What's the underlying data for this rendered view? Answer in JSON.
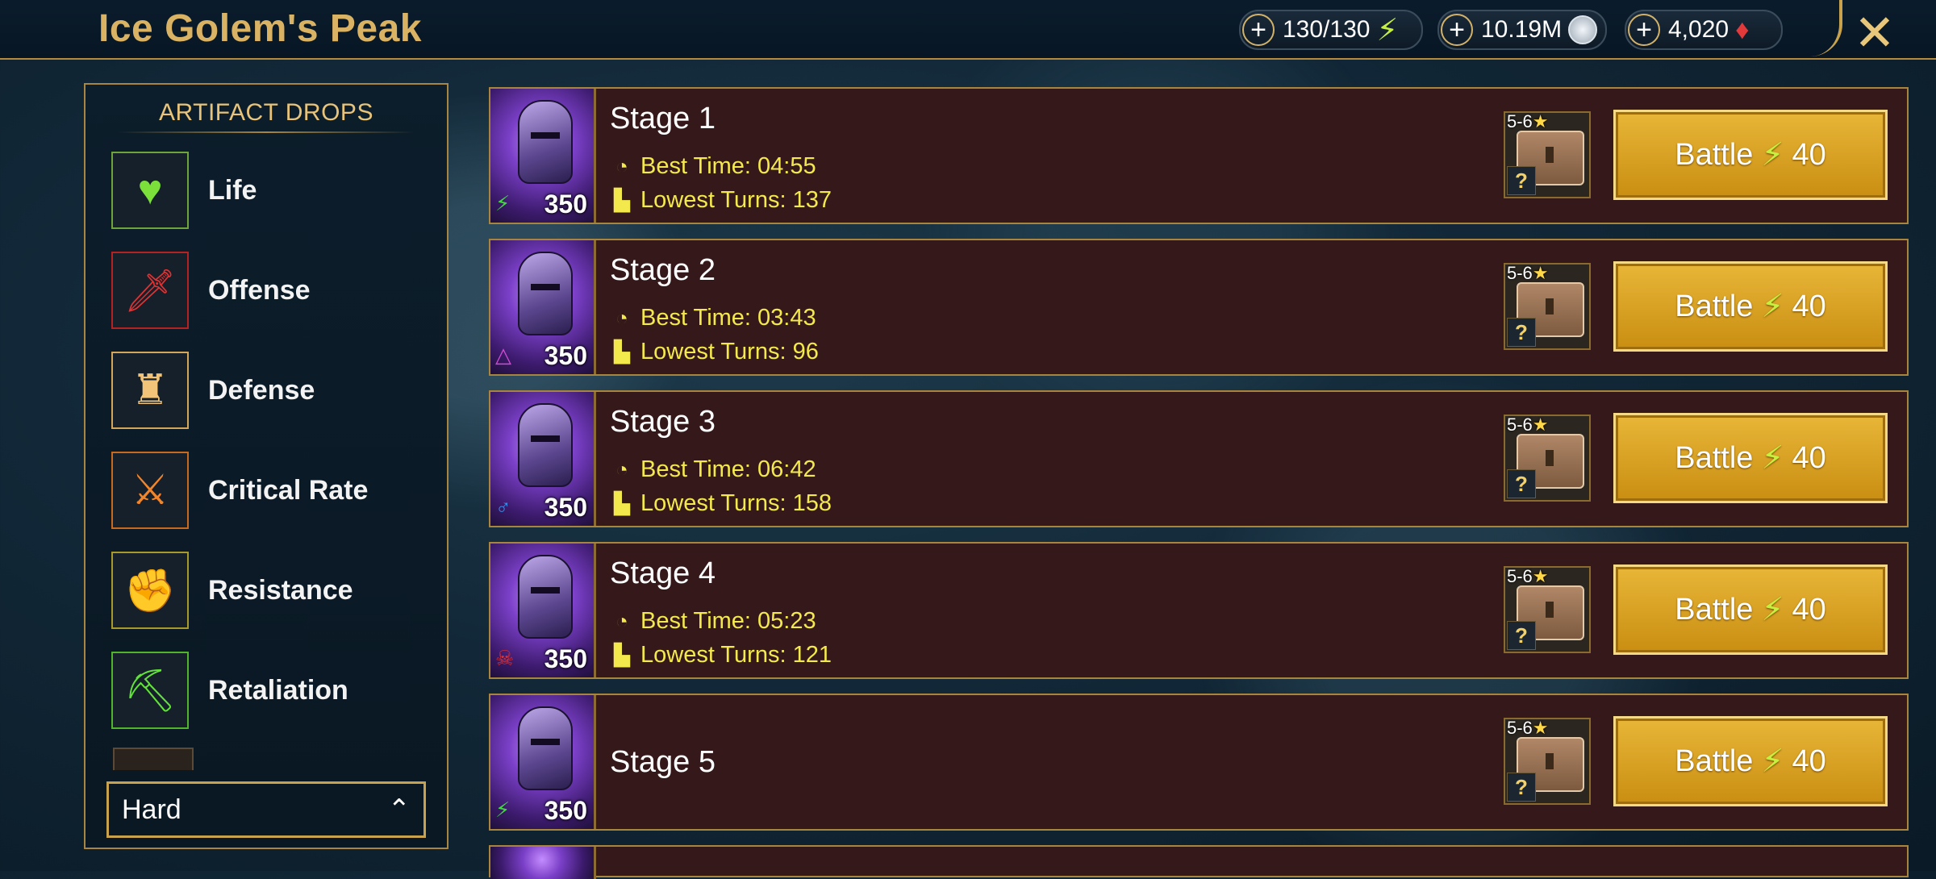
{
  "header": {
    "title": "Ice Golem's Peak",
    "resources": [
      {
        "name": "energy",
        "value": "130/130",
        "icon": "lightning-icon",
        "color": "#c6f040"
      },
      {
        "name": "silver",
        "value": "10.19M",
        "icon": "silver-coin-icon",
        "color": "#cfd8e0"
      },
      {
        "name": "gems",
        "value": "4,020",
        "icon": "ruby-gem-icon",
        "color": "#e23a3a"
      }
    ],
    "plus_symbol": "+",
    "close_symbol": "✕"
  },
  "sidebar": {
    "heading": "ARTIFACT DROPS",
    "items": [
      {
        "label": "Life",
        "icon": "heart-icon",
        "glyph": "♥",
        "color": "#7be13a",
        "border": "#6ea43a"
      },
      {
        "label": "Offense",
        "icon": "sword-icon",
        "glyph": "🗡",
        "color": "#e23232",
        "border": "#b42222"
      },
      {
        "label": "Defense",
        "icon": "tower-icon",
        "glyph": "♜",
        "color": "#f1c47a",
        "border": "#d4a65a"
      },
      {
        "label": "Critical Rate",
        "icon": "crossed-swords-icon",
        "glyph": "⚔",
        "color": "#f2852a",
        "border": "#c76a1f"
      },
      {
        "label": "Resistance",
        "icon": "fist-icon",
        "glyph": "✊",
        "color": "#d6c63a",
        "border": "#a89a2a"
      },
      {
        "label": "Retaliation",
        "icon": "pickaxe-icon",
        "glyph": "⛏",
        "color": "#62e23a",
        "border": "#52b42c"
      }
    ],
    "difficulty": {
      "value": "Hard",
      "chevron": "⌃"
    }
  },
  "stages": [
    {
      "name": "Stage 1",
      "energy_cost": "350",
      "affinity_glyph": "⚡",
      "affinity_color": "#45d645",
      "best_time": "Best Time: 04:55",
      "lowest_turns": "Lowest Turns: 137",
      "reward_rarity": "5-6",
      "reward_star": "★",
      "reward_unknown": "?",
      "battle_label": "Battle",
      "battle_cost": "40",
      "battle_bolt": "⚡"
    },
    {
      "name": "Stage 2",
      "energy_cost": "350",
      "affinity_glyph": "△",
      "affinity_color": "#d14ad1",
      "best_time": "Best Time: 03:43",
      "lowest_turns": "Lowest Turns: 96",
      "reward_rarity": "5-6",
      "reward_star": "★",
      "reward_unknown": "?",
      "battle_label": "Battle",
      "battle_cost": "40",
      "battle_bolt": "⚡"
    },
    {
      "name": "Stage 3",
      "energy_cost": "350",
      "affinity_glyph": "♂",
      "affinity_color": "#3a8ee8",
      "best_time": "Best Time: 06:42",
      "lowest_turns": "Lowest Turns: 158",
      "reward_rarity": "5-6",
      "reward_star": "★",
      "reward_unknown": "?",
      "battle_label": "Battle",
      "battle_cost": "40",
      "battle_bolt": "⚡"
    },
    {
      "name": "Stage 4",
      "energy_cost": "350",
      "affinity_glyph": "☠",
      "affinity_color": "#e03030",
      "best_time": "Best Time: 05:23",
      "lowest_turns": "Lowest Turns: 121",
      "reward_rarity": "5-6",
      "reward_star": "★",
      "reward_unknown": "?",
      "battle_label": "Battle",
      "battle_cost": "40",
      "battle_bolt": "⚡"
    },
    {
      "name": "Stage 5",
      "energy_cost": "350",
      "affinity_glyph": "⚡",
      "affinity_color": "#45d645",
      "best_time": "",
      "lowest_turns": "",
      "reward_rarity": "5-6",
      "reward_star": "★",
      "reward_unknown": "?",
      "battle_label": "Battle",
      "battle_cost": "40",
      "battle_bolt": "⚡"
    }
  ],
  "stat_icons": {
    "time": "clock-icon",
    "turns": "boot-icon"
  }
}
